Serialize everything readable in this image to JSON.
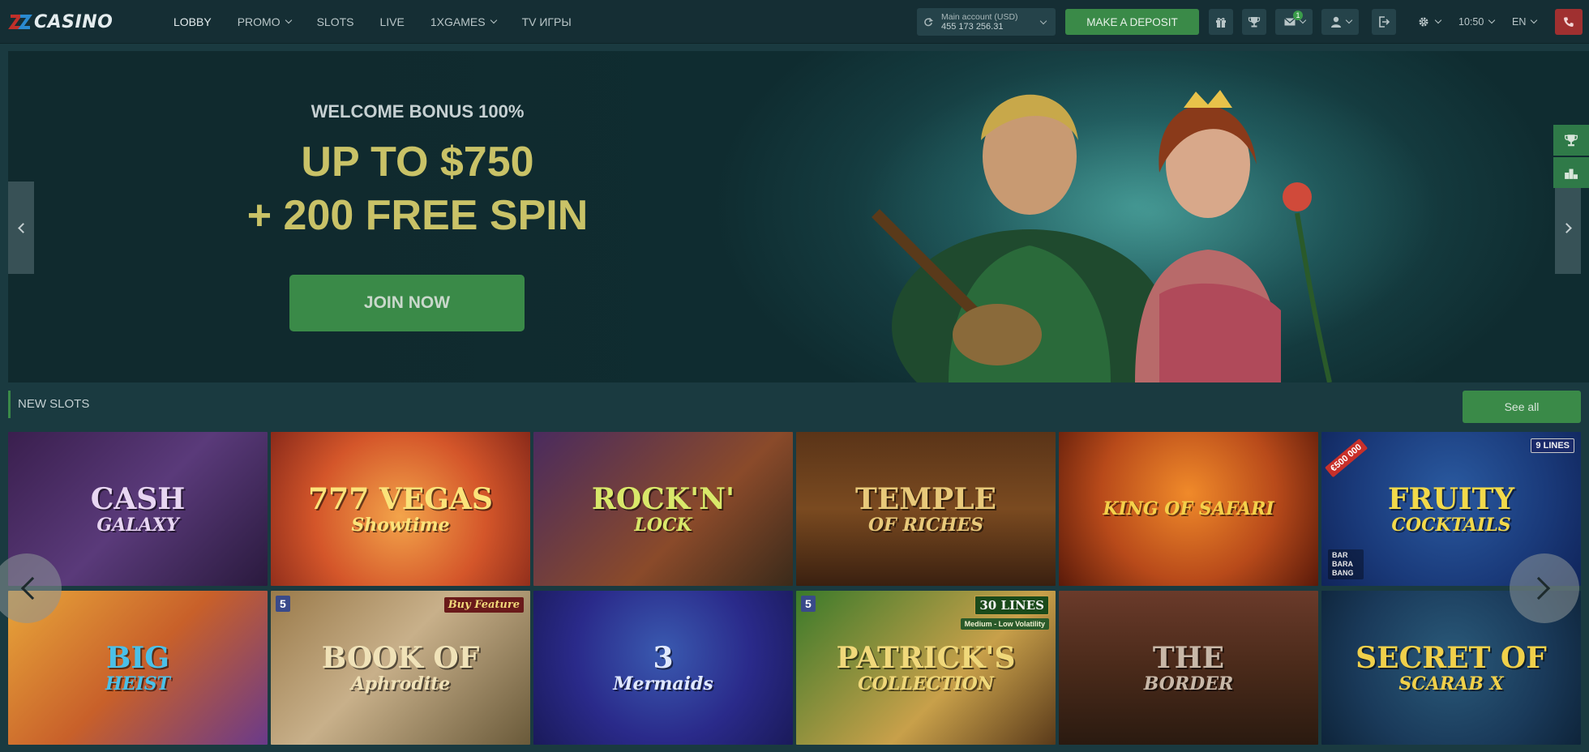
{
  "header": {
    "logo_text": "CASINO",
    "nav": [
      {
        "label": "LOBBY",
        "active": true,
        "dropdown": false
      },
      {
        "label": "PROMO",
        "active": false,
        "dropdown": true
      },
      {
        "label": "SLOTS",
        "active": false,
        "dropdown": false
      },
      {
        "label": "LIVE",
        "active": false,
        "dropdown": false
      },
      {
        "label": "1XGAMES",
        "active": false,
        "dropdown": true
      },
      {
        "label": "TV ИГРЫ",
        "active": false,
        "dropdown": false
      }
    ],
    "account": {
      "title": "Main account (USD)",
      "balance": "455 173 256.31"
    },
    "deposit_label": "MAKE A DEPOSIT",
    "messages_badge": "1",
    "time": "10:50",
    "language": "EN",
    "icons": [
      "refresh-icon",
      "gift-icon",
      "trophy-icon",
      "mail-icon",
      "user-icon",
      "logout-icon",
      "gear-icon",
      "phone-icon"
    ]
  },
  "hero": {
    "subtitle": "WELCOME BONUS 100%",
    "title_line1": "UP TO $750",
    "title_line2": "+ 200 FREE SPIN",
    "cta": "JOIN NOW"
  },
  "side_widgets": [
    "trophy-icon",
    "podium-icon"
  ],
  "section": {
    "title": "NEW SLOTS",
    "see_all": "See all"
  },
  "slots": [
    {
      "name": "CASH",
      "sub": "GALAXY",
      "bg": "linear-gradient(135deg,#3a1f4e,#5a3a7a 50%,#2a1a3e)",
      "color": "#e8d6f2"
    },
    {
      "name": "777 VEGAS",
      "sub": "Showtime",
      "bg": "radial-gradient(circle at 50% 55%,#f3a44a,#d4562a 55%,#8a2a1a)",
      "color": "#fbe37a"
    },
    {
      "name": "ROCK'N'",
      "sub": "LOCK",
      "bg": "linear-gradient(135deg,#4a2b5e,#8a4a2a 60%,#3a2a1a)",
      "color": "#d9e86a"
    },
    {
      "name": "TEMPLE",
      "sub": "OF RICHES",
      "bg": "linear-gradient(180deg,#5a3418,#7a4a20 50%,#3a2010)",
      "color": "#e8c97a"
    },
    {
      "name": "",
      "sub": "KING OF SAFARI",
      "bg": "radial-gradient(circle at 50% 40%,#f08a2a,#b84a1a 55%,#5a1a0a)",
      "color": "#f4d04a"
    },
    {
      "name": "FRUITY",
      "sub": "COCKTAILS",
      "bg": "radial-gradient(circle at 50% 40%,#2a5aa0,#1a3a7a 60%,#10245a)",
      "color": "#f2d94a"
    },
    {
      "name": "BIG",
      "sub": "HEIST",
      "bg": "linear-gradient(135deg,#e8a63a,#c8602a 50%,#6a3a8a)",
      "color": "#4ac0e8"
    },
    {
      "name": "BOOK OF",
      "sub": "Aphrodite",
      "bg": "linear-gradient(135deg,#9a7a4a,#c8b08a 45%,#6a5a3a)",
      "color": "#f0e2b8"
    },
    {
      "name": "3",
      "sub": "Mermaids",
      "bg": "radial-gradient(circle at 50% 40%,#3a5ab0,#2a2a8a 55%,#1a1a5a)",
      "color": "#e0e8ff"
    },
    {
      "name": "PATRICK'S",
      "sub": "COLLECTION",
      "bg": "linear-gradient(135deg,#3a7a2a,#c8a04a 60%,#5a3a1a)",
      "color": "#f0d87a"
    },
    {
      "name": "THE",
      "sub": "BORDER",
      "bg": "linear-gradient(180deg,#6a3a2a,#4a2a1a 50%,#2a1a10)",
      "color": "#c8b8a8"
    },
    {
      "name": "SECRET OF",
      "sub": "SCARAB X",
      "bg": "radial-gradient(circle at 50% 45%,#2a5a7a,#1a3a5a 60%,#0e243a)",
      "color": "#f0d04a"
    }
  ],
  "slot_tags": {
    "fruity_lines": "9 LINES",
    "fruity_promo": "€500 000",
    "fruity_brand": "BAR BARA BANG",
    "aphrodite_tag": "Buy Feature",
    "aphrodite_badge": "5",
    "patrick_lines": "30 LINES",
    "patrick_volatility": "Medium - Low Volatility",
    "patrick_badge": "5"
  },
  "colors": {
    "accent": "#3a8a48",
    "header_bg": "#152e34",
    "page_bg": "#1a3a40",
    "hero_gold": "#c9c267",
    "danger": "#a03030"
  }
}
